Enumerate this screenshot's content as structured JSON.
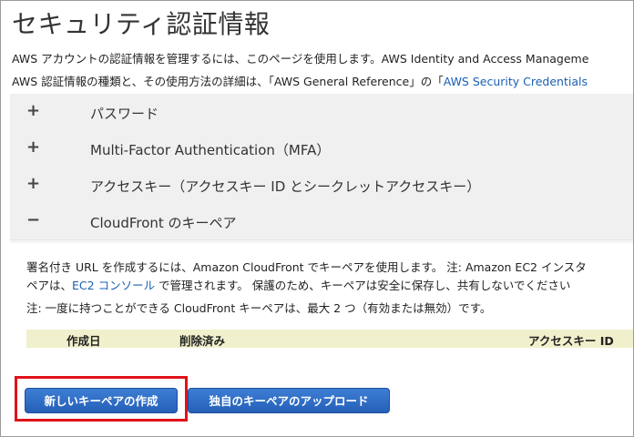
{
  "page": {
    "title": "セキュリティ認証情報",
    "intro_line1": "AWS アカウントの認証情報を管理するには、このページを使用します。AWS Identity and Access Manageme",
    "intro_line2_prefix": "AWS 認証情報の種類と、その使用方法の詳細は、「AWS General Reference」の「",
    "intro_line2_link": "AWS Security Credentials"
  },
  "sections": [
    {
      "label": "パスワード",
      "sign": "+"
    },
    {
      "label": "Multi-Factor Authentication（MFA）",
      "sign": "+"
    },
    {
      "label": "アクセスキー（アクセスキー ID とシークレットアクセスキー）",
      "sign": "+"
    },
    {
      "label": "CloudFront のキーペア",
      "sign": "−"
    }
  ],
  "cloudfront": {
    "desc_line1": "署名付き URL を作成するには、Amazon CloudFront でキーペアを使用します。 注: Amazon EC2 インスタ",
    "desc_line2_prefix": "ペアは、",
    "desc_line2_link": "EC2 コンソール",
    "desc_line2_suffix": " で管理されます。 保護のため、キーペアは安全に保存し、共有しないでください",
    "note": "注: 一度に持つことができる CloudFront キーペアは、最大 2 つ（有効または無効）です。",
    "table_headers": {
      "created": "作成日",
      "deleted": "削除済み",
      "access_key_id": "アクセスキー ID"
    },
    "create_button": "新しいキーペアの作成",
    "upload_button": "独自のキーペアのアップロード"
  },
  "colors": {
    "accent": "#2a67bf",
    "highlight_box": "#e0121a",
    "table_header_bg": "#f0f0cc"
  }
}
